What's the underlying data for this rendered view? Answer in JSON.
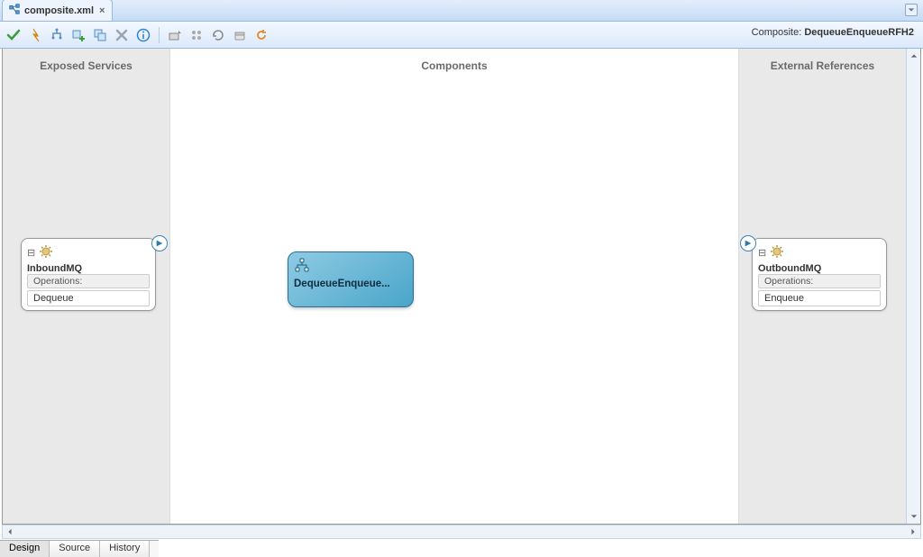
{
  "tab": {
    "filename": "composite.xml"
  },
  "toolbar": {
    "composite_prefix": "Composite:",
    "composite_name": "DequeueEnqueueRFH2"
  },
  "lanes": {
    "left_title": "Exposed Services",
    "mid_title": "Components",
    "right_title": "External References"
  },
  "services": {
    "inbound": {
      "name": "InboundMQ",
      "ops_label": "Operations:",
      "operation": "Dequeue"
    },
    "outbound": {
      "name": "OutboundMQ",
      "ops_label": "Operations:",
      "operation": "Enqueue"
    }
  },
  "component": {
    "label": "DequeueEnqueue..."
  },
  "bottom_tabs": {
    "design": "Design",
    "source": "Source",
    "history": "History"
  }
}
